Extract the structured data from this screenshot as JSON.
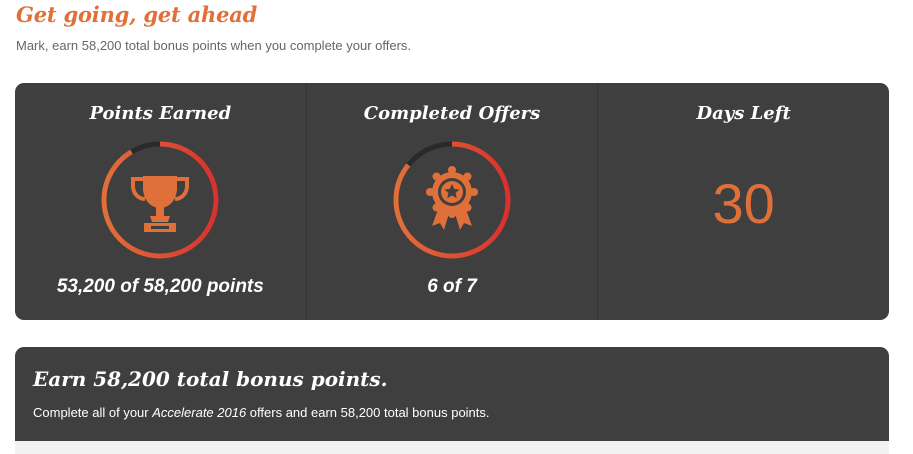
{
  "header": {
    "title": "Get going, get ahead",
    "subtitle": "Mark, earn 58,200 total bonus points when you complete your offers."
  },
  "stats": {
    "points": {
      "heading": "Points Earned",
      "value": "53,200 of 58,200 points",
      "icon": "trophy-icon",
      "progress": 0.914
    },
    "offers": {
      "heading": "Completed Offers",
      "value": "6 of 7",
      "icon": "award-ribbon-icon",
      "progress": 0.857
    },
    "days": {
      "heading": "Days Left",
      "value": "30"
    }
  },
  "bonus": {
    "title": "Earn 58,200 total bonus points.",
    "desc_before": "Complete all of your ",
    "desc_em": "Accelerate 2016",
    "desc_after": " offers and earn 58,200 total bonus points."
  },
  "colors": {
    "accent": "#e0703a",
    "ring_red": "#d8322e",
    "ring_track": "#2a2a2a",
    "panel_bg": "#403f3f"
  }
}
